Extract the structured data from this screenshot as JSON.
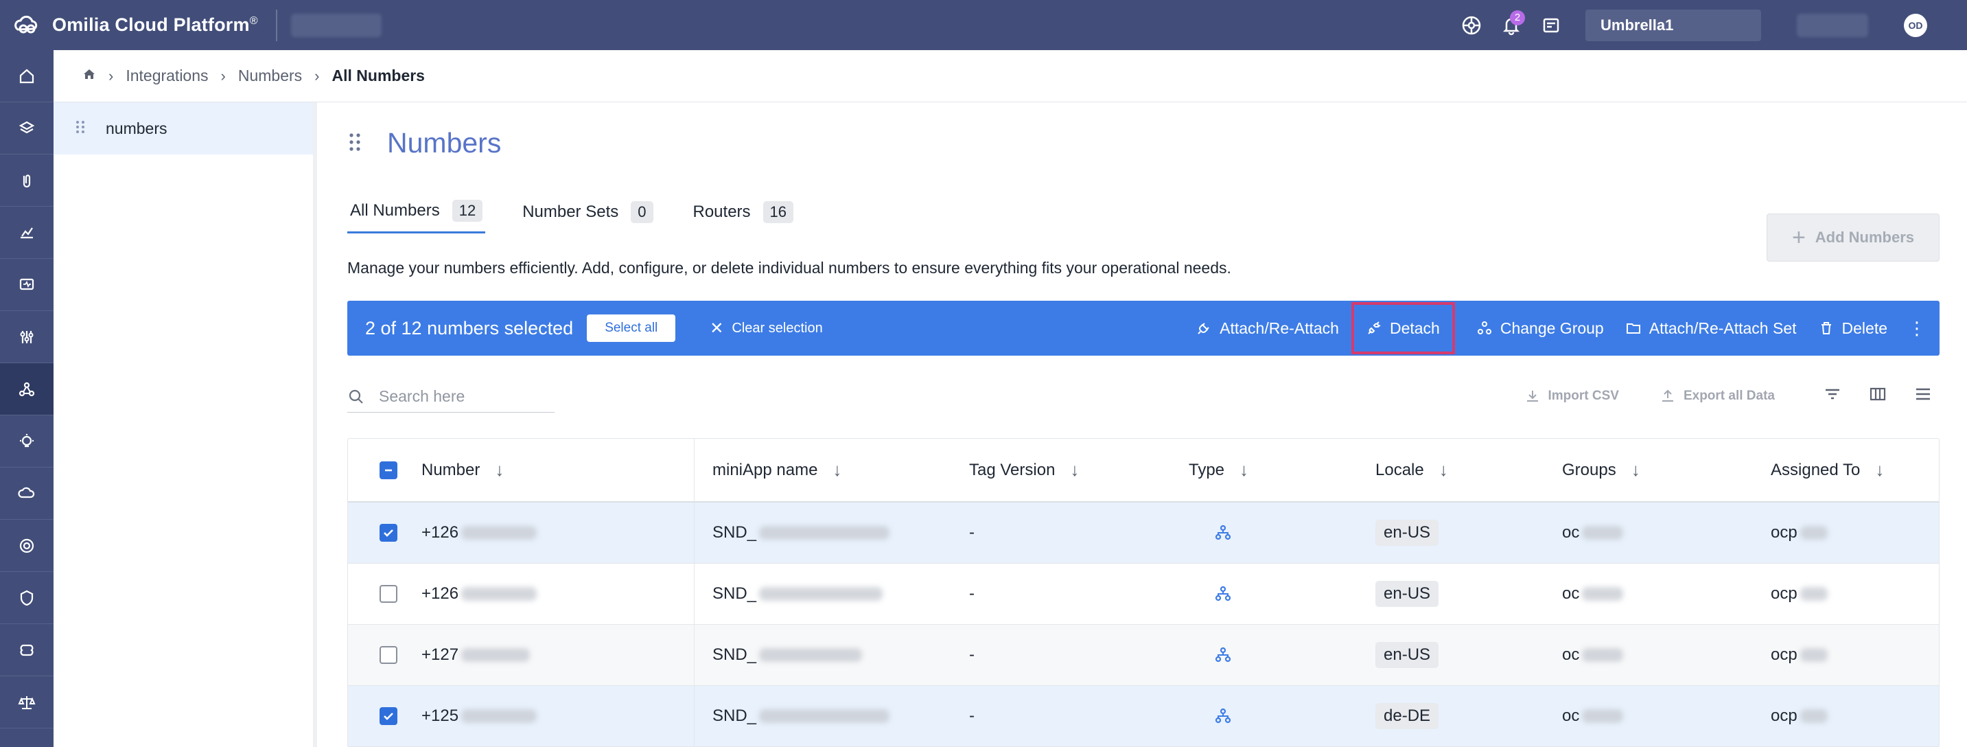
{
  "app": {
    "name": "Omilia Cloud Platform",
    "registered": "®",
    "notifications_count": "2",
    "org": "Umbrella1",
    "avatar_initials": "OD"
  },
  "breadcrumb": {
    "items": [
      "Integrations",
      "Numbers"
    ],
    "current": "All Numbers"
  },
  "panel": {
    "items": [
      {
        "label": "numbers"
      }
    ]
  },
  "page": {
    "title": "Numbers",
    "description": "Manage your numbers efficiently. Add, configure, or delete individual numbers to ensure everything fits your operational needs.",
    "add_button": "Add Numbers"
  },
  "tabs": [
    {
      "label": "All Numbers",
      "count": "12",
      "active": true
    },
    {
      "label": "Number Sets",
      "count": "0",
      "active": false
    },
    {
      "label": "Routers",
      "count": "16",
      "active": false
    }
  ],
  "selection_bar": {
    "count_text": "2 of 12 numbers selected",
    "select_all": "Select all",
    "clear_selection": "Clear selection",
    "actions": {
      "attach": "Attach/Re-Attach",
      "detach": "Detach",
      "change_group": "Change Group",
      "attach_set": "Attach/Re-Attach Set",
      "delete": "Delete"
    },
    "highlight_color": "#d43b6e",
    "bar_color": "#3d7ce6"
  },
  "toolbar": {
    "search_placeholder": "Search here",
    "import_csv": "Import CSV",
    "export_all": "Export all Data"
  },
  "table": {
    "columns": [
      "Number",
      "miniApp name",
      "Tag Version",
      "Type",
      "Locale",
      "Groups",
      "Assigned To"
    ],
    "rows": [
      {
        "number": "+126",
        "miniapp": "SND_",
        "tag": "-",
        "locale": "en-US",
        "groups": "oc",
        "assigned": "ocp",
        "checked": true
      },
      {
        "number": "+126",
        "miniapp": "SND_",
        "tag": "-",
        "locale": "en-US",
        "groups": "oc",
        "assigned": "ocp",
        "checked": false
      },
      {
        "number": "+127",
        "miniapp": "SND_",
        "tag": "-",
        "locale": "en-US",
        "groups": "oc",
        "assigned": "ocp",
        "checked": false
      },
      {
        "number": "+125",
        "miniapp": "SND_",
        "tag": "-",
        "locale": "de-DE",
        "groups": "oc",
        "assigned": "ocp",
        "checked": true
      }
    ]
  }
}
